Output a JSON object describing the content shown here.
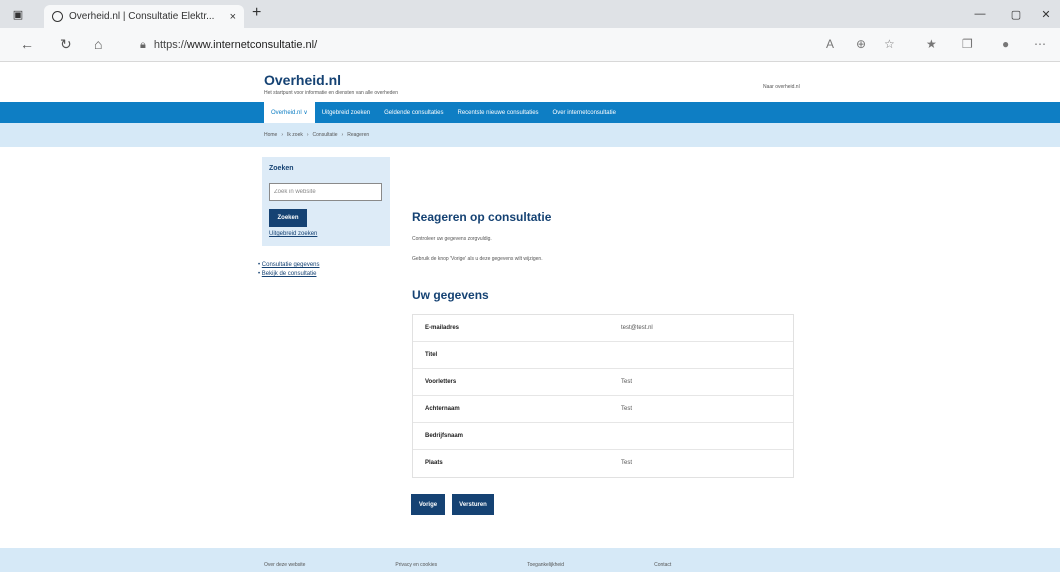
{
  "browser": {
    "tab_title": "Overheid.nl | Consultatie Elektr...",
    "tab_close": "×",
    "new_tab": "+",
    "url_scheme": "https://",
    "url_host": "www.internetconsultatie.nl/",
    "window_controls": {
      "minimize": "—",
      "restore": "▢",
      "close": "✕"
    }
  },
  "site": {
    "logo": "Overheid.nl",
    "tagline": "Het startpunt voor informatie en diensten van alle overheden",
    "header_link": "Naar overheid.nl"
  },
  "nav": {
    "items": [
      {
        "label": "Overheid.nl ∨",
        "active": true
      },
      {
        "label": "Uitgebreid zoeken",
        "active": false
      },
      {
        "label": "Geldende consultaties",
        "active": false
      },
      {
        "label": "Recentste nieuwe consultaties",
        "active": false
      },
      {
        "label": "Over internetconsultatie",
        "active": false
      }
    ]
  },
  "breadcrumb": [
    "Home",
    "›",
    "Ik zoek",
    "›",
    "Consultatie",
    "›",
    "Reageren"
  ],
  "sidebar": {
    "title": "Zoeken",
    "search_placeholder": "Zoek in website",
    "search_button": "Zoeken",
    "advanced_link": "Uitgebreid zoeken",
    "links": [
      "Consultatie gegevens",
      "Bekijk de consultatie"
    ]
  },
  "main": {
    "title": "Reageren op consultatie",
    "intro": "Controleer uw gegevens zorgvuldig.",
    "intro2": "Gebruik de knop 'Vorige' als u deze gegevens wilt wijzigen.",
    "section_title": "Uw gegevens",
    "details": [
      {
        "label": "E-mailadres",
        "value": "test@test.nl"
      },
      {
        "label": "Titel",
        "value": ""
      },
      {
        "label": "Voorletters",
        "value": "Test"
      },
      {
        "label": "Achternaam",
        "value": "Test"
      },
      {
        "label": "Bedrijfsnaam",
        "value": ""
      },
      {
        "label": "Plaats",
        "value": "Test"
      }
    ],
    "back_button": "Vorige",
    "submit_button": "Versturen"
  },
  "footer": {
    "links": [
      "Over deze website",
      "Privacy en cookies",
      "Toegankelijkheid",
      "Contact"
    ]
  }
}
